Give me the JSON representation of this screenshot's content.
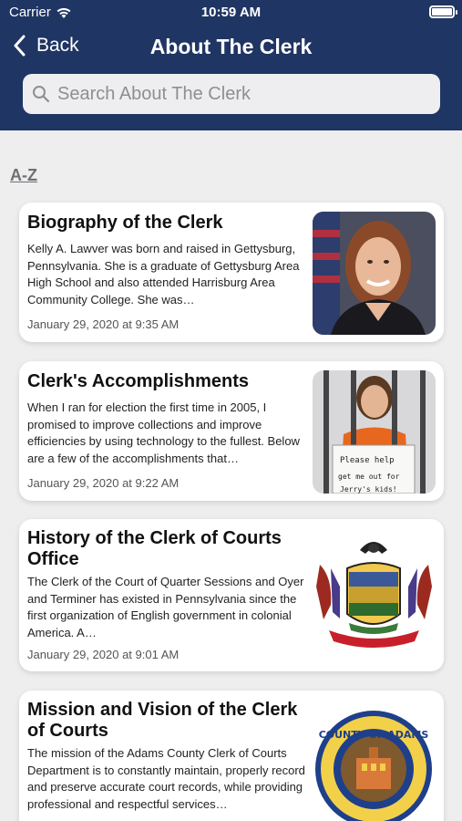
{
  "status_bar": {
    "carrier": "Carrier",
    "time": "10:59 AM"
  },
  "nav": {
    "back_label": "Back",
    "title": "About The Clerk"
  },
  "search": {
    "placeholder": "Search About The Clerk"
  },
  "section": {
    "label": "A-Z"
  },
  "articles": [
    {
      "title": "Biography of the Clerk",
      "excerpt": "Kelly A. Lawver was born and raised in Gettysburg, Pennsylvania.  She is a graduate of Gettysburg Area High School and also attended Harrisburg Area Community College.  She was…",
      "date": "January 29, 2020 at 9:35 AM"
    },
    {
      "title": "Clerk's Accomplishments",
      "excerpt": "When I ran for election the first time in 2005, I promised to improve collections and improve efficiencies by using technology to the fullest. Below are a few of the accomplishments that…",
      "date": "January 29, 2020 at 9:22 AM",
      "sign_text_1": "Please help",
      "sign_text_2": "get me out for",
      "sign_text_3": "Jerry's kids!"
    },
    {
      "title": "History of the Clerk of Courts Office",
      "excerpt": "The Clerk of the Court of Quarter Sessions and Oyer and Terminer has existed in Pennsylvania since the first organization of English government in colonial America. A…",
      "date": "January 29, 2020 at 9:01 AM"
    },
    {
      "title": "Mission and Vision of the Clerk of Courts",
      "excerpt": "The mission of the Adams County Clerk of Courts Department is to constantly maintain, properly record and preserve accurate court records, while providing professional and respectful services…",
      "seal_text": "COUNTY OF ADAMS"
    }
  ]
}
